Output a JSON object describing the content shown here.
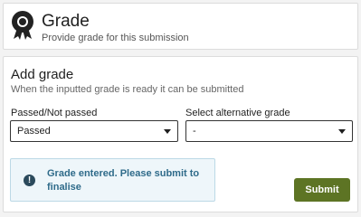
{
  "header": {
    "title": "Grade",
    "subtitle": "Provide grade for this submission",
    "icon": "award-ribbon-icon"
  },
  "form": {
    "title": "Add grade",
    "subtitle": "When the inputted grade is ready it can be submitted",
    "passed_label": "Passed/Not passed",
    "passed_value": "Passed",
    "alt_label": "Select alternative grade",
    "alt_value": "-",
    "alert_text": "Grade entered. Please submit to finalise",
    "submit_label": "Submit"
  },
  "colors": {
    "accent": "#5d7424",
    "alert_bg": "#eef6fa",
    "alert_text": "#2f6b8a"
  }
}
